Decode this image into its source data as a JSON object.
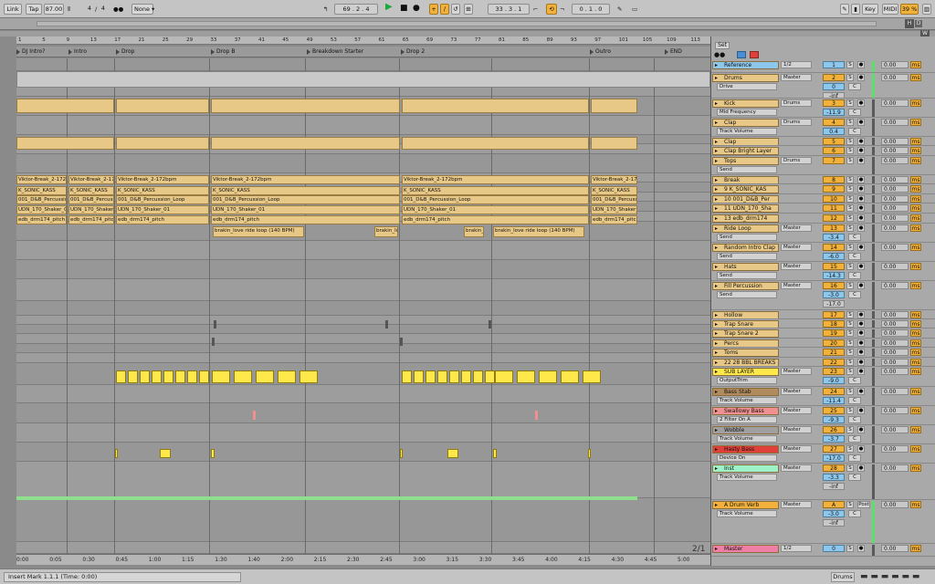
{
  "transport": {
    "link": "Link",
    "tap": "Tap",
    "tempo": "87.00",
    "sig_num": "4",
    "sig_den": "4",
    "quant": "None",
    "position": "69 . 2 . 4",
    "loop_start": "33 . 3 . 1",
    "loop_length": "0 . 1 . 0",
    "key": "Key",
    "midi": "MIDI",
    "cpu": "39 %",
    "d": "D",
    "h": "H",
    "w": "W"
  },
  "bar_numbers": [
    "1",
    "5",
    "9",
    "13",
    "17",
    "21",
    "25",
    "29",
    "33",
    "37",
    "41",
    "45",
    "49",
    "53",
    "57",
    "61",
    "65",
    "69",
    "73",
    "77",
    "81",
    "85",
    "89",
    "93",
    "97",
    "101",
    "105",
    "109",
    "113"
  ],
  "markers": [
    {
      "label": "DJ Intro?",
      "pos": 0
    },
    {
      "label": "Intro",
      "pos": 57
    },
    {
      "label": "Drop",
      "pos": 109
    },
    {
      "label": "Drop B",
      "pos": 213
    },
    {
      "label": "Breakdown Starter",
      "pos": 318
    },
    {
      "label": "Drop 2",
      "pos": 421
    },
    {
      "label": "Outro",
      "pos": 628
    },
    {
      "label": "END",
      "pos": 710
    }
  ],
  "time_labels": [
    "0:00",
    "0:05",
    "0:30",
    "0:45",
    "1:00",
    "1:15",
    "1:30",
    "1:40",
    "2:00",
    "2:15",
    "2:30",
    "2:45",
    "3:00",
    "3:15",
    "3:30",
    "3:45",
    "4:00",
    "4:15",
    "4:30",
    "4:45",
    "5:00"
  ],
  "clip_texts": {
    "viktor": "Viktor-Break_2-172bpm",
    "sonic": "K_SONIC_KASS",
    "shaker": "UDN_170_Shaker_01",
    "perc": "001_D&B_Percussion_Loop",
    "drm": "edb_drm174_pitch",
    "ride": "brakin_love ride loop (140 BPM)",
    "ride_short": "brakin_lo"
  },
  "page_counter": "2/1",
  "set_label": "Set",
  "tracks": [
    {
      "name": "Reference",
      "io": "1/2",
      "num": "1",
      "vol": "0.00",
      "color": "#8ec7ec",
      "row": 0
    },
    {
      "name": "Drums",
      "io": "Master",
      "num": "2",
      "vol": "0.00",
      "sub": "Drive",
      "val": "0",
      "val2": "-inf",
      "color": "#e8c887",
      "row": 1
    },
    {
      "name": "Kick",
      "io": "Drums",
      "num": "3",
      "vol": "0.00",
      "sub": "Mid Frequency",
      "val": "-11.9",
      "color": "#e8c887",
      "row": 2
    },
    {
      "name": "Clap",
      "io": "Drums",
      "num": "4",
      "vol": "0.00",
      "sub": "Track Volume",
      "val": "0.4",
      "color": "#e8c887",
      "row": 3
    },
    {
      "name": "Clap",
      "num": "5",
      "vol": "0.00",
      "color": "#e8c887",
      "row": 4
    },
    {
      "name": "Clap Bright Layer",
      "num": "6",
      "vol": "0.00",
      "color": "#e8c887",
      "row": 5
    },
    {
      "name": "Tops",
      "io": "Drums",
      "num": "7",
      "vol": "0.00",
      "sub": "Send",
      "color": "#e8c887",
      "row": 6
    },
    {
      "name": "Break",
      "num": "8",
      "vol": "0.00",
      "color": "#e8c887",
      "row": 7
    },
    {
      "name": "9 K_SONIC_KAS",
      "num": "9",
      "vol": "0.00",
      "color": "#e8c887",
      "row": 8
    },
    {
      "name": "10 001_D&B_Per",
      "num": "10",
      "vol": "0.00",
      "color": "#e8c887",
      "row": 9
    },
    {
      "name": "11 UDN_170_Sha",
      "num": "11",
      "vol": "0.00",
      "color": "#e8c887",
      "row": 10
    },
    {
      "name": "13 edb_drm174",
      "num": "12",
      "vol": "0.00",
      "color": "#e8c887",
      "row": 11
    },
    {
      "name": "Ride Loop",
      "io": "Master",
      "num": "13",
      "vol": "0.00",
      "sub": "Send",
      "val": "-3.4",
      "color": "#e8c887",
      "row": 12
    },
    {
      "name": "Random Intro Clap",
      "io": "Master",
      "num": "14",
      "vol": "0.00",
      "sub": "Send",
      "val": "-6.0",
      "color": "#e8c887",
      "row": 13
    },
    {
      "name": "Hats",
      "io": "Master",
      "num": "15",
      "vol": "0.00",
      "sub": "Send",
      "val": "-14.3",
      "color": "#e8c887",
      "row": 14
    },
    {
      "name": "Fill Percussion",
      "io": "Master",
      "num": "16",
      "vol": "0.00",
      "sub": "Send",
      "val": "-3.0",
      "val2": "-17.0",
      "color": "#e8c887",
      "row": 15
    },
    {
      "name": "Hollow",
      "num": "17",
      "vol": "0.00",
      "color": "#e8c887",
      "row": 16
    },
    {
      "name": "Trap Snare",
      "num": "18",
      "vol": "0.00",
      "color": "#e8c887",
      "row": 17
    },
    {
      "name": "Trap Snare 2",
      "num": "19",
      "vol": "0.00",
      "color": "#e8c887",
      "row": 18
    },
    {
      "name": "Percs",
      "num": "20",
      "vol": "0.00",
      "color": "#e8c887",
      "row": 19
    },
    {
      "name": "Toms",
      "num": "21",
      "vol": "0.00",
      "color": "#e8c887",
      "row": 20
    },
    {
      "name": "22 28 BBL BREAKS",
      "num": "22",
      "vol": "0.00",
      "color": "#e8c887",
      "row": 21
    },
    {
      "name": "SUB LAYER",
      "io": "Master",
      "num": "23",
      "vol": "0.00",
      "sub": "OutputTrim",
      "val": "-9.0",
      "color": "#ffe84a",
      "row": 22
    },
    {
      "name": "Bass Stab",
      "io": "Master",
      "num": "24",
      "vol": "0.00",
      "sub": "Track Volume",
      "val": "-11.4",
      "color": "#b08b5e",
      "row": 23
    },
    {
      "name": "Swallowy Bass",
      "io": "Master",
      "num": "25",
      "vol": "0.00",
      "sub": "2 Filter On A",
      "val": "-9.3",
      "color": "#f09090",
      "row": 24
    },
    {
      "name": "Wobble",
      "io": "Master",
      "num": "26",
      "vol": "0.00",
      "sub": "Track Volume",
      "val": "-3.7",
      "color": "#a0a0a0",
      "row": 25
    },
    {
      "name": "Hasty Bass",
      "io": "Master",
      "num": "27",
      "vol": "0.00",
      "sub": "Device On",
      "val": "-17.0",
      "color": "#e0403a",
      "row": 26
    },
    {
      "name": "Inst",
      "io": "Master",
      "num": "28",
      "vol": "0.00",
      "sub": "Track Volume",
      "val": "-3.3",
      "val2": "-inf",
      "color": "#9ef2c8",
      "row": 27
    },
    {
      "name": "A Drum Verb",
      "io": "Master",
      "num": "A",
      "vol": "0.00",
      "sub": "Track Volume",
      "val": "-3.0",
      "val2": "-inf",
      "post": "Post",
      "color": "#f2b13b",
      "row": 28
    },
    {
      "name": "Master",
      "io": "1/2",
      "num": "0",
      "vol": "0.00",
      "color": "#f07fa8",
      "row": 29
    }
  ],
  "status": {
    "text": "Insert Mark 1.1.1 (Time: 0:00)",
    "track": "Drums"
  }
}
